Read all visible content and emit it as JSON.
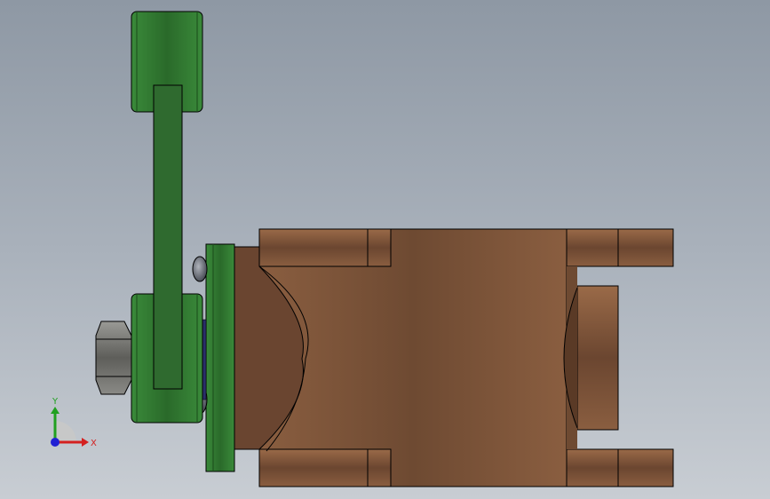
{
  "viewport": {
    "colors": {
      "background_top": "#8e98a4",
      "background_bottom": "#c8cdd3",
      "lever": "#2f6a2f",
      "lever_highlight": "#3f8a3f",
      "body": "#7a5238",
      "body_dark": "#5a3a26",
      "nut": "#6a6a66",
      "edge": "#000000"
    }
  },
  "triad": {
    "x_label": "X",
    "y_label": "Y",
    "x_color": "#d42020",
    "y_color": "#20a020",
    "z_color": "#2020d4"
  }
}
